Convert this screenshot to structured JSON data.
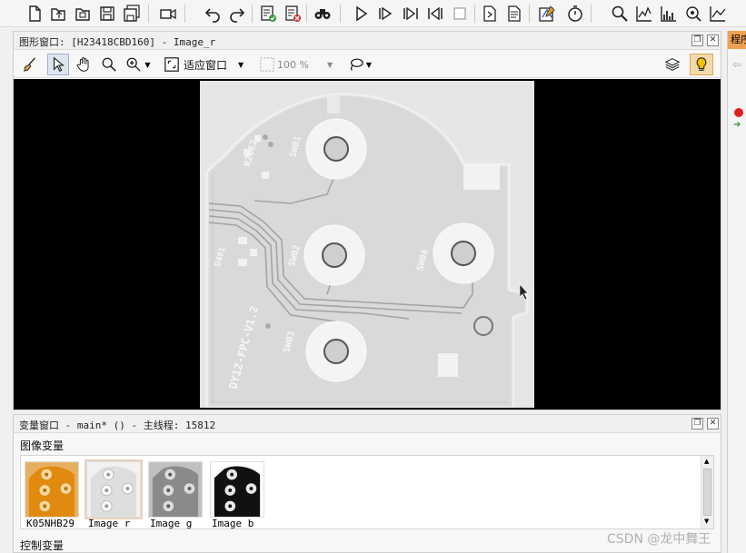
{
  "toolbar": {
    "buttons": [
      {
        "name": "new-file-icon"
      },
      {
        "name": "open-file-icon"
      },
      {
        "name": "open-example-icon"
      },
      {
        "name": "save-icon"
      },
      {
        "name": "save-all-icon"
      },
      {
        "name": "record-icon"
      },
      {
        "name": "undo-icon"
      },
      {
        "name": "redo-icon"
      },
      {
        "name": "check-program-icon"
      },
      {
        "name": "remove-error-icon"
      },
      {
        "name": "binoculars-icon"
      },
      {
        "name": "run-icon"
      },
      {
        "name": "step-into-icon"
      },
      {
        "name": "step-over-icon"
      },
      {
        "name": "step-out-icon"
      },
      {
        "name": "stop-icon"
      },
      {
        "name": "reset-icon"
      },
      {
        "name": "document-icon"
      },
      {
        "name": "assistant-icon"
      },
      {
        "name": "stopwatch-icon"
      },
      {
        "name": "zoom-icon"
      },
      {
        "name": "line-profile-icon"
      },
      {
        "name": "histogram-icon"
      },
      {
        "name": "feature-inspection-icon"
      },
      {
        "name": "plot-icon"
      }
    ]
  },
  "graphics_window": {
    "title": "图形窗口: [H23418CBD160] - Image_r",
    "fit_label": "适应窗口",
    "zoom_value": "100 %"
  },
  "variable_window": {
    "title": "变量窗口 - main* () - 主线程: 15812",
    "image_vars_label": "图像变量",
    "control_vars_label": "控制变量",
    "images": [
      {
        "label": "K05NHB29",
        "tint": "#e89a2a"
      },
      {
        "label": "Image_r",
        "tint": "#eeeeee"
      },
      {
        "label": "Image_g",
        "tint": "#9a9a9a"
      },
      {
        "label": "Image_b",
        "tint": "#111111"
      }
    ]
  },
  "right_panel": {
    "tab_label": "程序"
  },
  "watermark": "CSDN @龙中舞王",
  "colors": {
    "accent": "#f0a050",
    "canvas": "#000000"
  }
}
